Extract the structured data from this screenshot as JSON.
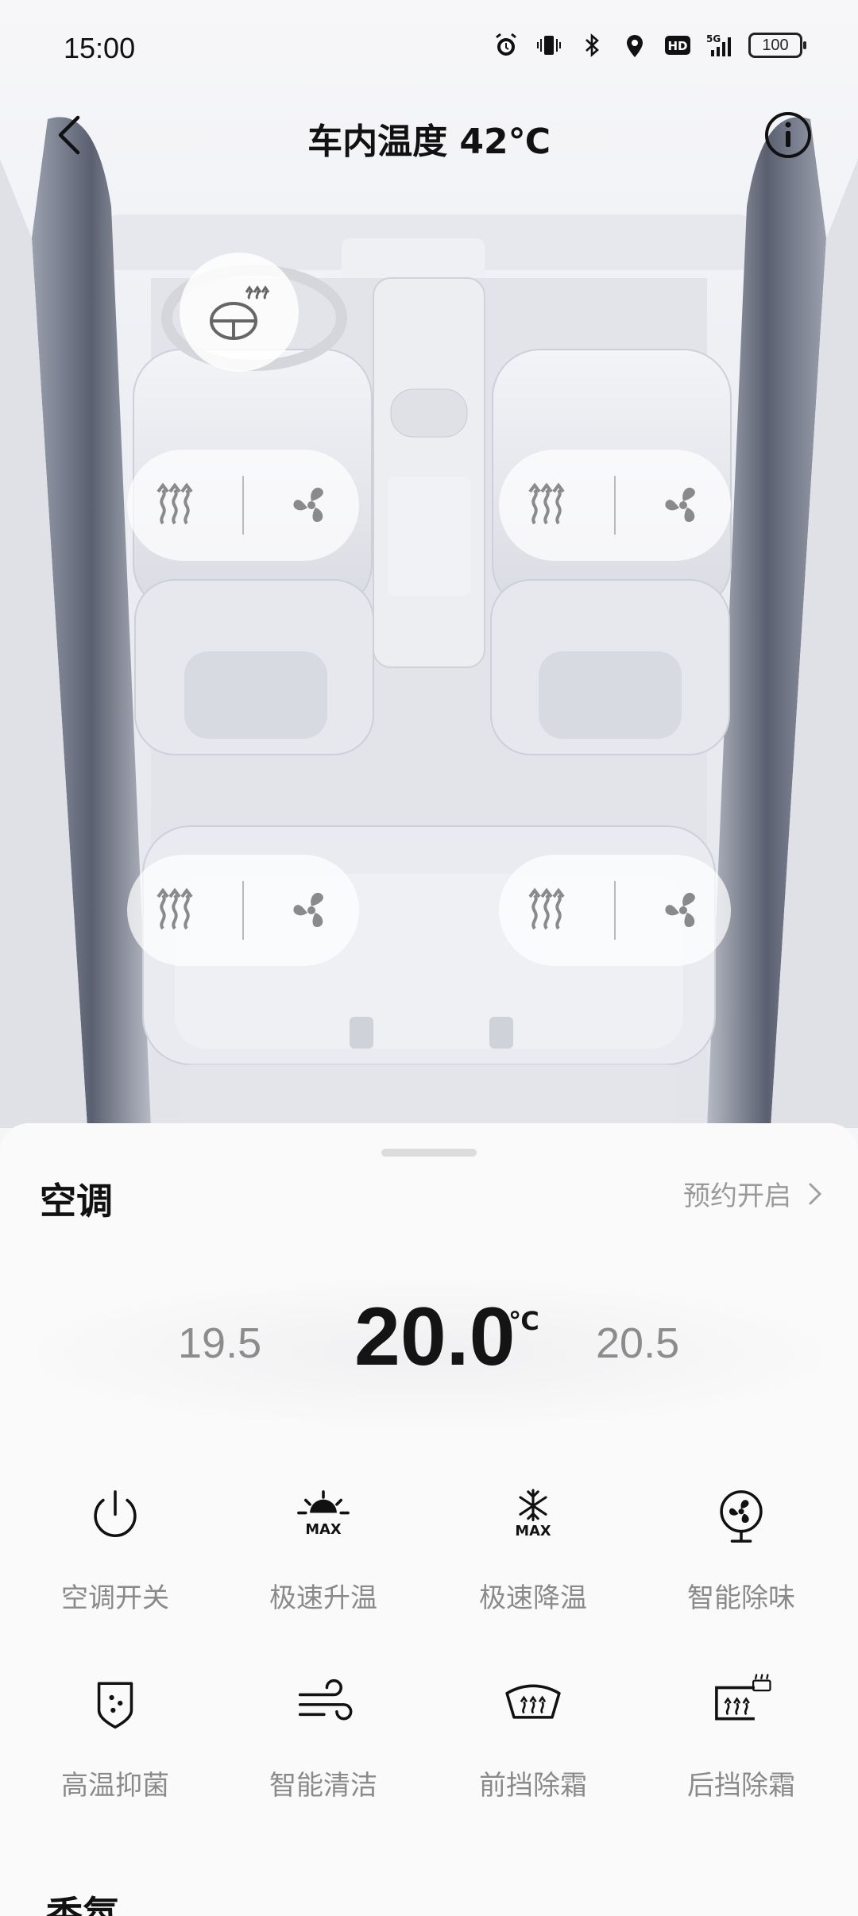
{
  "status_bar": {
    "time": "15:00",
    "battery": "100",
    "icons": [
      "alarm-icon",
      "vibrate-icon",
      "bluetooth-icon",
      "location-icon",
      "hd-icon",
      "signal-5g-icon",
      "battery-icon"
    ]
  },
  "header": {
    "title": "车内温度 42℃"
  },
  "car": {
    "steering_heat_icon": "steering-wheel-heat-icon",
    "seats": [
      {
        "id": "front-left",
        "heat_icon": "seat-heat-icon",
        "vent_icon": "seat-vent-icon"
      },
      {
        "id": "front-right",
        "heat_icon": "seat-heat-icon",
        "vent_icon": "seat-vent-icon"
      },
      {
        "id": "rear-left",
        "heat_icon": "seat-heat-icon",
        "vent_icon": "seat-vent-icon"
      },
      {
        "id": "rear-right",
        "heat_icon": "seat-heat-icon",
        "vent_icon": "seat-vent-icon"
      }
    ]
  },
  "ac": {
    "title": "空调",
    "schedule_label": "预约开启",
    "temp_prev": "19.5",
    "temp_current": "20.0",
    "temp_unit": "℃",
    "temp_next": "20.5",
    "functions": [
      {
        "label": "空调开关",
        "icon": "power-icon"
      },
      {
        "label": "极速升温",
        "icon": "max-heat-icon"
      },
      {
        "label": "极速降温",
        "icon": "max-cool-icon"
      },
      {
        "label": "智能除味",
        "icon": "deodorize-icon"
      },
      {
        "label": "高温抑菌",
        "icon": "sterilize-icon"
      },
      {
        "label": "智能清洁",
        "icon": "clean-icon"
      },
      {
        "label": "前挡除霜",
        "icon": "front-defrost-icon"
      },
      {
        "label": "后挡除霜",
        "icon": "rear-defrost-icon"
      }
    ]
  },
  "fragrance": {
    "title": "香氛"
  },
  "colors": {
    "background": "#f6f6f8",
    "text_primary": "#111111",
    "text_secondary": "#8a8a8a"
  }
}
